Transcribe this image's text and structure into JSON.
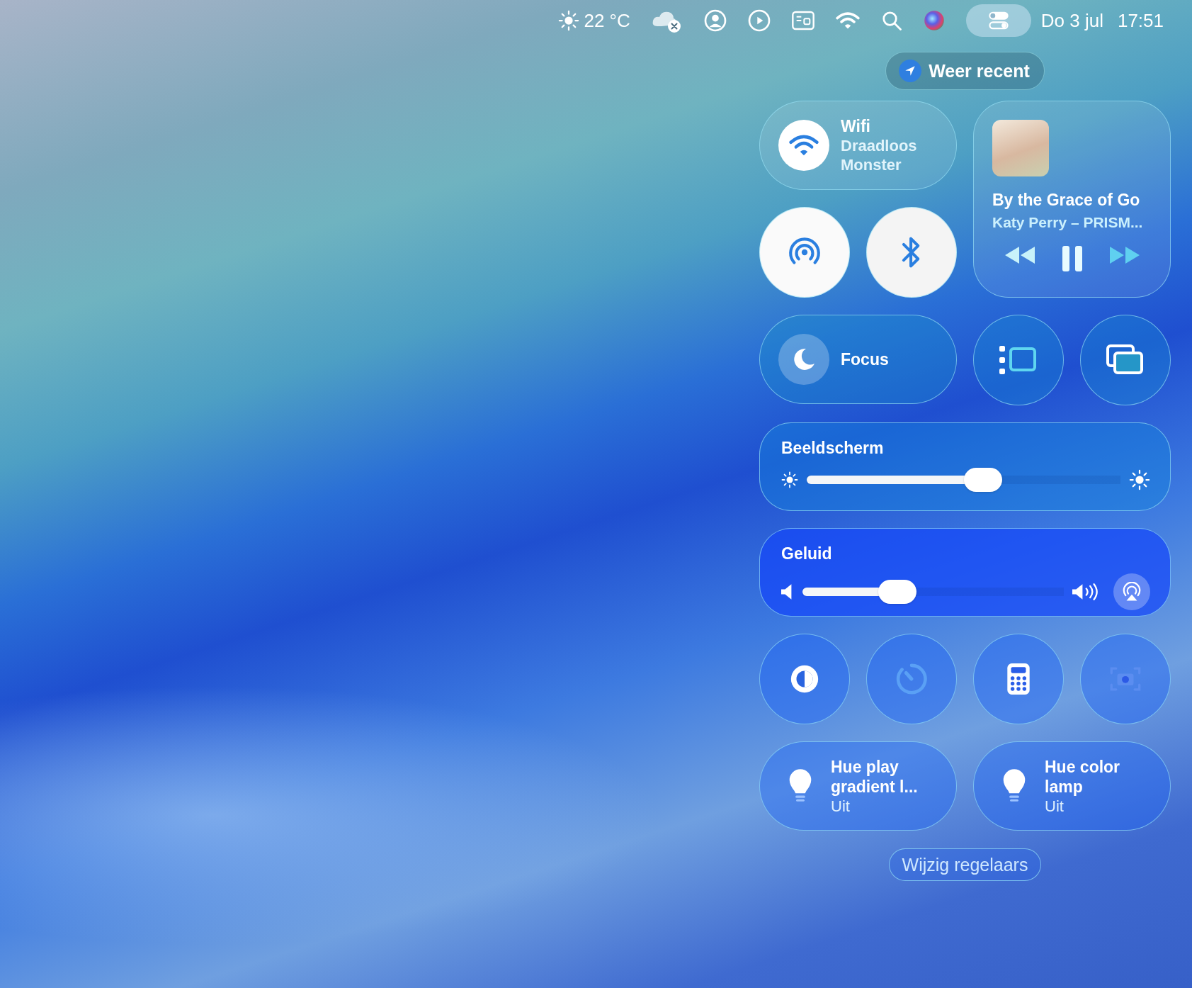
{
  "menu_bar": {
    "weather": "22 °C",
    "control_center_active": true,
    "date": "Do 3 jul",
    "time": "17:51"
  },
  "location_pill": {
    "label": "Weer recent"
  },
  "wifi": {
    "title": "Wifi",
    "network": "Draadloos Monster",
    "on": true
  },
  "airdrop": {
    "on": true
  },
  "bluetooth": {
    "on": true
  },
  "now_playing": {
    "title": "By the Grace of Go",
    "subtitle": "Katy Perry – PRISM...",
    "playing": true
  },
  "focus": {
    "label": "Focus",
    "on": false
  },
  "small_controls": [
    {
      "kind": "stage-manager"
    },
    {
      "kind": "screen-mirroring"
    }
  ],
  "display": {
    "label": "Beeldscherm",
    "level": 0.57
  },
  "sound": {
    "label": "Geluid",
    "level": 0.34
  },
  "quick_buttons": [
    {
      "kind": "dark-mode"
    },
    {
      "kind": "timer"
    },
    {
      "kind": "calculator"
    },
    {
      "kind": "screenshot"
    }
  ],
  "lights": [
    {
      "name": "Hue play gradient l...",
      "state": "Uit",
      "on": false
    },
    {
      "name": "Hue color lamp",
      "state": "Uit",
      "on": false
    }
  ],
  "edit_button": {
    "label": "Wijzig regelaars"
  }
}
